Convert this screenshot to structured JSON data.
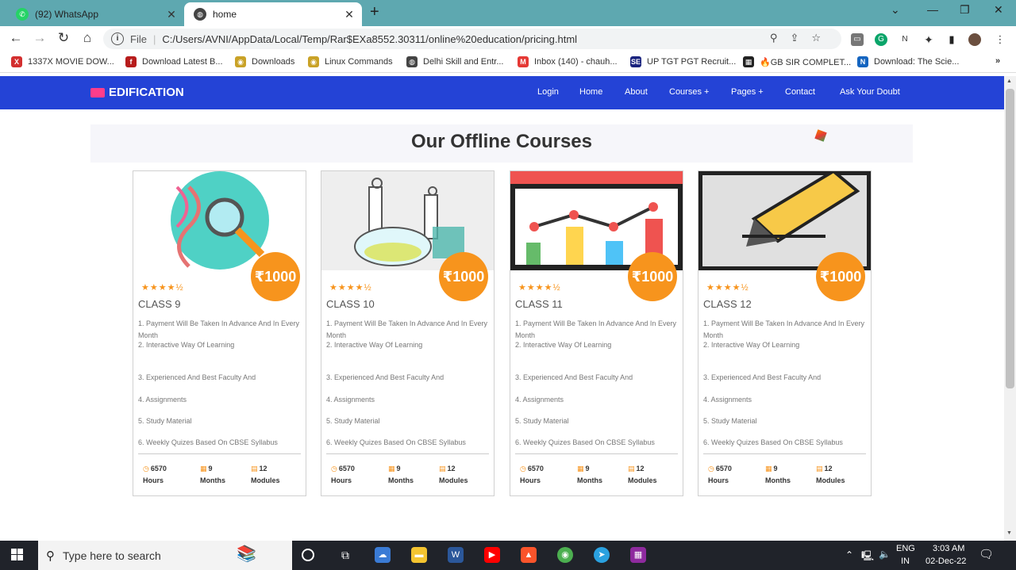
{
  "browser": {
    "tabs": [
      {
        "title": "(92) WhatsApp",
        "icon": "whatsapp-icon",
        "badge": "92"
      },
      {
        "title": "home",
        "icon": "globe-icon"
      }
    ],
    "address": {
      "scheme_label": "File",
      "url": "C:/Users/AVNI/AppData/Local/Temp/Rar$EXa8552.30311/online%20education/pricing.html"
    },
    "bookmarks": [
      {
        "label": "1337X MOVIE DOW...",
        "icon": "x-icon",
        "color": "#d32f2f"
      },
      {
        "label": "Download Latest B...",
        "icon": "f-icon",
        "color": "#b71c1c"
      },
      {
        "label": "Downloads",
        "icon": "disc-icon",
        "color": "#c9a227"
      },
      {
        "label": "Linux Commands",
        "icon": "disc-icon",
        "color": "#c9a227"
      },
      {
        "label": "Delhi Skill and Entr...",
        "icon": "globe-icon",
        "color": "#444444"
      },
      {
        "label": "Inbox (140) - chauh...",
        "icon": "gmail-icon",
        "color": "#e53935"
      },
      {
        "label": "UP TGT PGT Recruit...",
        "icon": "se-icon",
        "color": "#1a237e"
      },
      {
        "label": "🔥GB SIR COMPLET...",
        "icon": "grid-icon",
        "color": "#222222"
      },
      {
        "label": "Download: The Scie...",
        "icon": "na-icon",
        "color": "#1565c0"
      }
    ],
    "more_bookmarks": "»"
  },
  "site": {
    "brand": "EDIFICATION",
    "nav": [
      "Login",
      "Home",
      "About",
      "Courses +",
      "Pages +",
      "Contact",
      "Ask Your Doubt"
    ],
    "heading": "Our Offline Courses",
    "courses": [
      {
        "title": "CLASS 9",
        "price": "₹1000",
        "rating": "★★★★½"
      },
      {
        "title": "CLASS 10",
        "price": "₹1000",
        "rating": "★★★★½"
      },
      {
        "title": "CLASS 11",
        "price": "₹1000",
        "rating": "★★★★½"
      },
      {
        "title": "CLASS 12",
        "price": "₹1000",
        "rating": "★★★★½"
      }
    ],
    "features": [
      "1. Payment Will Be Taken In Advance And In Every Month",
      "2. Interactive Way Of Learning",
      "3. Experienced And Best Faculty And",
      "4. Assignments",
      "5. Study Material",
      "6. Weekly Quizes Based On CBSE Syllabus"
    ],
    "stats": [
      {
        "value": "6570",
        "unit": "Hours",
        "icon": "clock-icon"
      },
      {
        "value": "9",
        "unit": "Months",
        "icon": "calendar-icon"
      },
      {
        "value": "12",
        "unit": "Modules",
        "icon": "book-icon"
      }
    ]
  },
  "taskbar": {
    "search_placeholder": "Type here to search",
    "lang_top": "ENG",
    "lang_bottom": "IN",
    "time": "3:03 AM",
    "date": "02-Dec-22"
  },
  "colors": {
    "accent": "#2443d6",
    "price": "#f7941d",
    "brand_pink": "#ff3d8b"
  }
}
